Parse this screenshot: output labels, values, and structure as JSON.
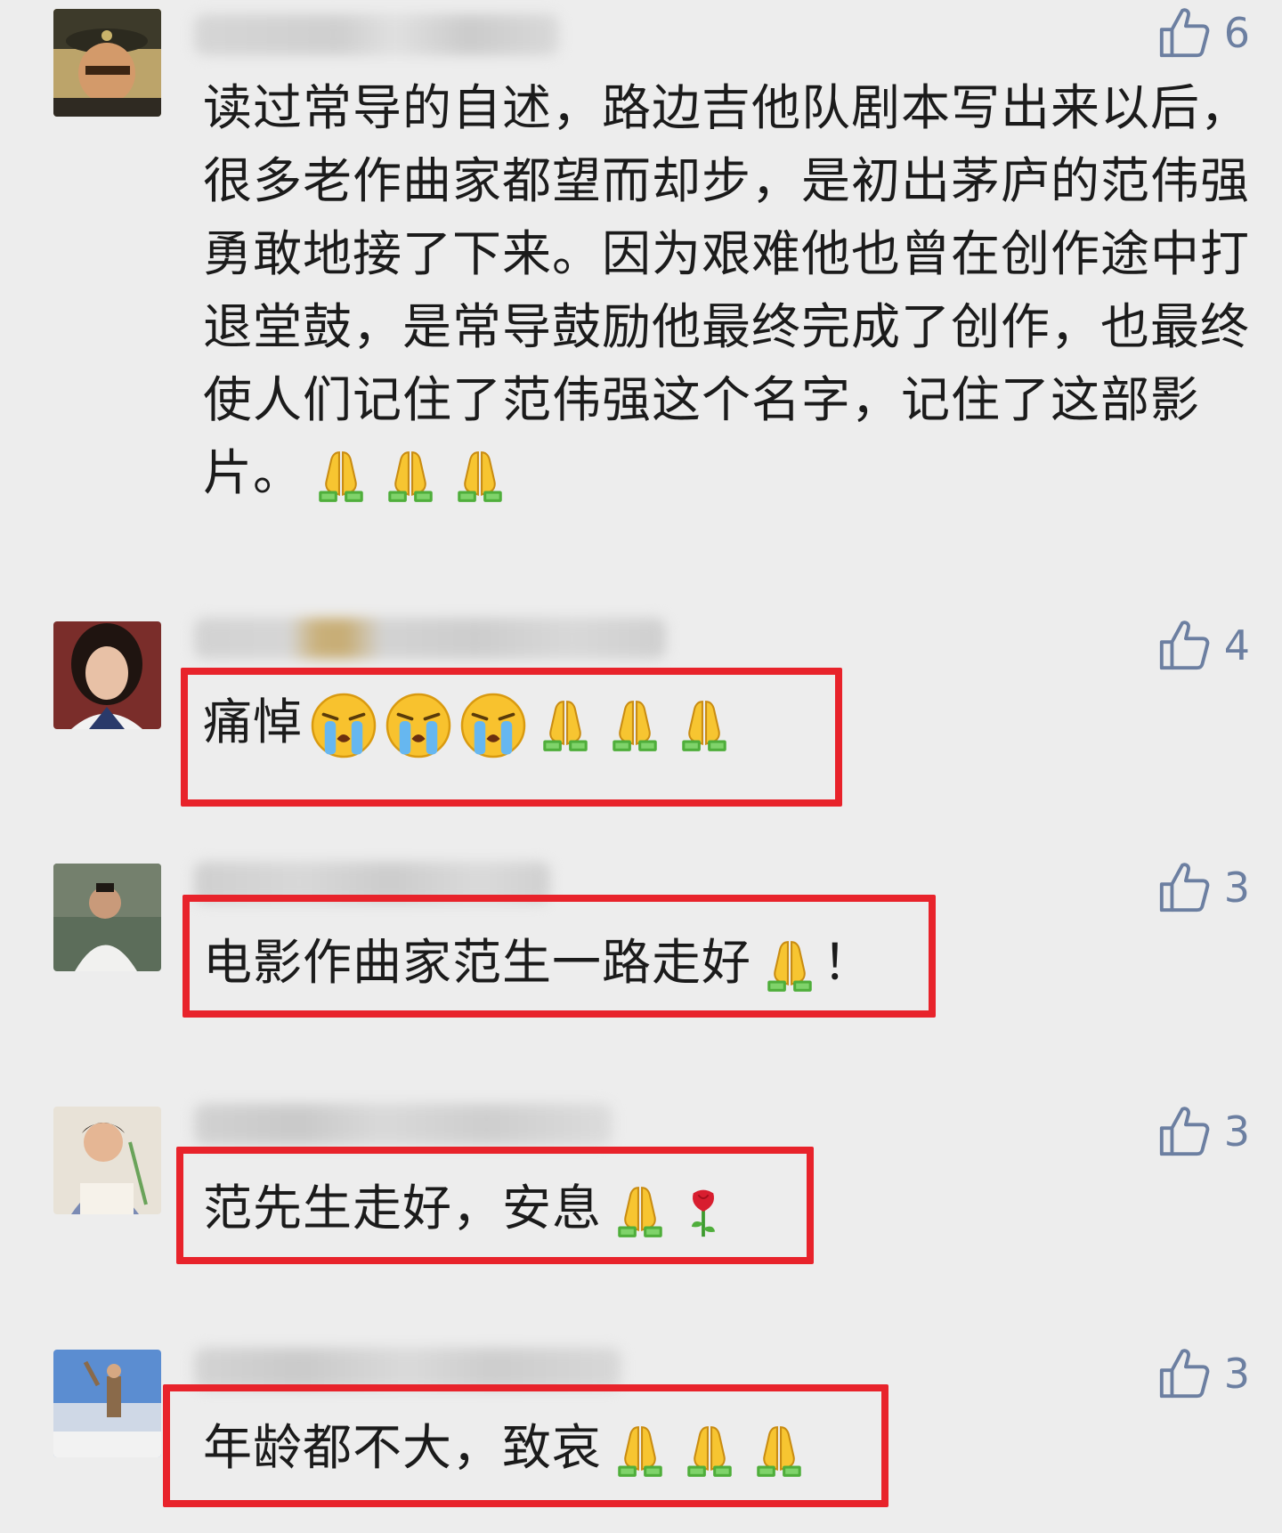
{
  "comments": [
    {
      "text": "读过常导的自述，路边吉他队剧本写出来以后，很多老作曲家都望而却步，是初出茅庐的范伟强勇敢地接了下来。因为艰难他也曾在创作途中打退堂鼓，是常导鼓励他最终完成了创作，也最终使人们记住了范伟强这个名字，记住了这部影片。",
      "emoji": [
        "pray-emoji",
        "pray-emoji",
        "pray-emoji"
      ],
      "likes": "6",
      "highlighted": false
    },
    {
      "text": "痛悼",
      "emoji": [
        "crying-face-emoji",
        "crying-face-emoji",
        "crying-face-emoji",
        "pray-emoji",
        "pray-emoji",
        "pray-emoji"
      ],
      "likes": "4",
      "highlighted": true
    },
    {
      "text": "电影作曲家范生一路走好",
      "emoji": [
        "pray-emoji"
      ],
      "suffix": "！",
      "likes": "3",
      "highlighted": true
    },
    {
      "text": "范先生走好，安息",
      "emoji": [
        "pray-emoji",
        "rose-emoji"
      ],
      "likes": "3",
      "highlighted": true
    },
    {
      "text": "年龄都不大，致哀",
      "emoji": [
        "pray-emoji",
        "pray-emoji",
        "pray-emoji"
      ],
      "likes": "3",
      "highlighted": true
    }
  ],
  "colors": {
    "background": "#ededed",
    "highlight": "#e8232b",
    "like": "#6c7fa1",
    "text": "#1b1b1b"
  },
  "icons": {
    "like": "thumbs-up-icon"
  }
}
